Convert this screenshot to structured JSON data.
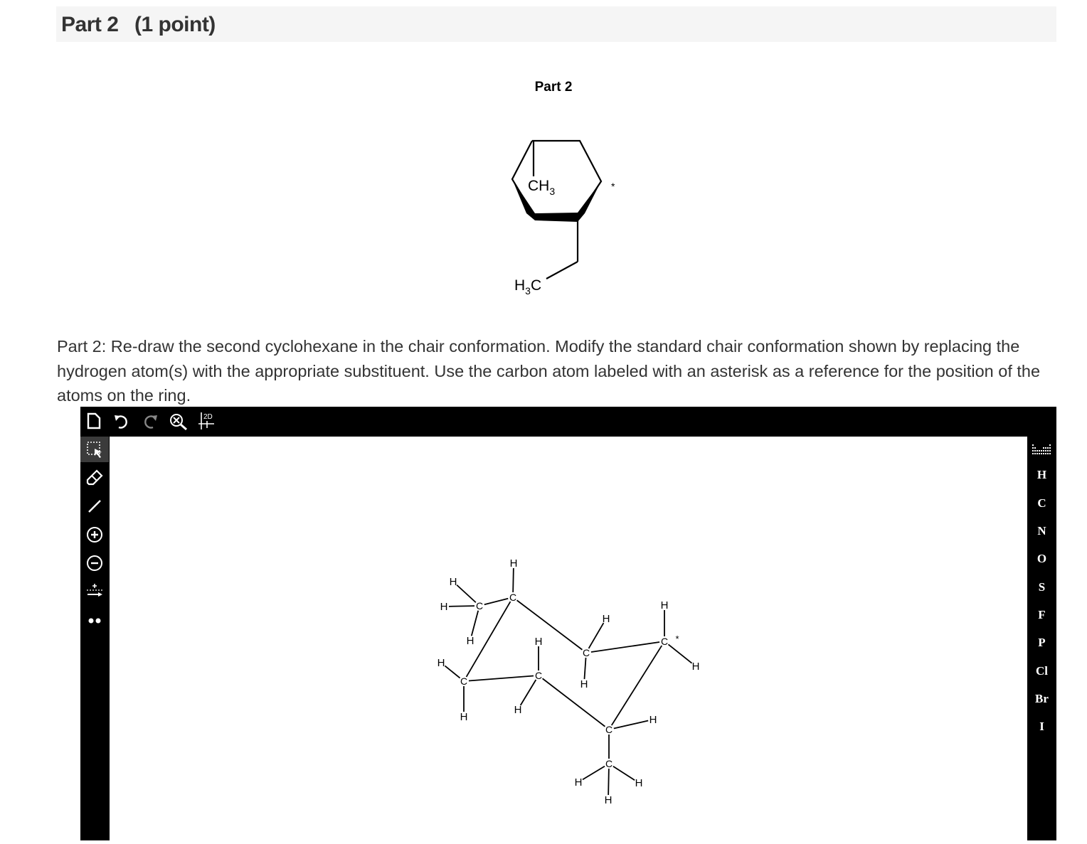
{
  "header": {
    "part_label": "Part 2",
    "points": "(1 point)"
  },
  "figure": {
    "title": "Part 2",
    "ring_substituent_top": "CH",
    "ring_substituent_top_sub": "3",
    "ring_substituent_bottom": "H",
    "ring_substituent_bottom_sub": "3",
    "ring_substituent_bottom_end": "C",
    "asterisk": "*"
  },
  "instructions": "Part 2: Re-draw the second cyclohexane in the chair conformation. Modify the standard chair conformation shown by replacing the hydrogen atom(s) with the appropriate substituent. Use the carbon atom labeled with an asterisk as a reference for the position of the atoms on the ring.",
  "editor": {
    "toolbar_icons": [
      "new-document-icon",
      "undo-icon",
      "redo-icon",
      "clean-zoom-icon",
      "2d-coordinates-icon"
    ],
    "clean_label": "2D",
    "left_tools": [
      "selection-tool",
      "eraser-tool",
      "bond-tool",
      "positive-charge-tool",
      "negative-charge-tool",
      "arrow-tool",
      "lone-pair-tool"
    ],
    "elements": [
      "H",
      "C",
      "N",
      "O",
      "S",
      "F",
      "P",
      "Cl",
      "Br",
      "I"
    ],
    "atom_labels": {
      "C": "C",
      "H": "H",
      "star": "*"
    }
  }
}
